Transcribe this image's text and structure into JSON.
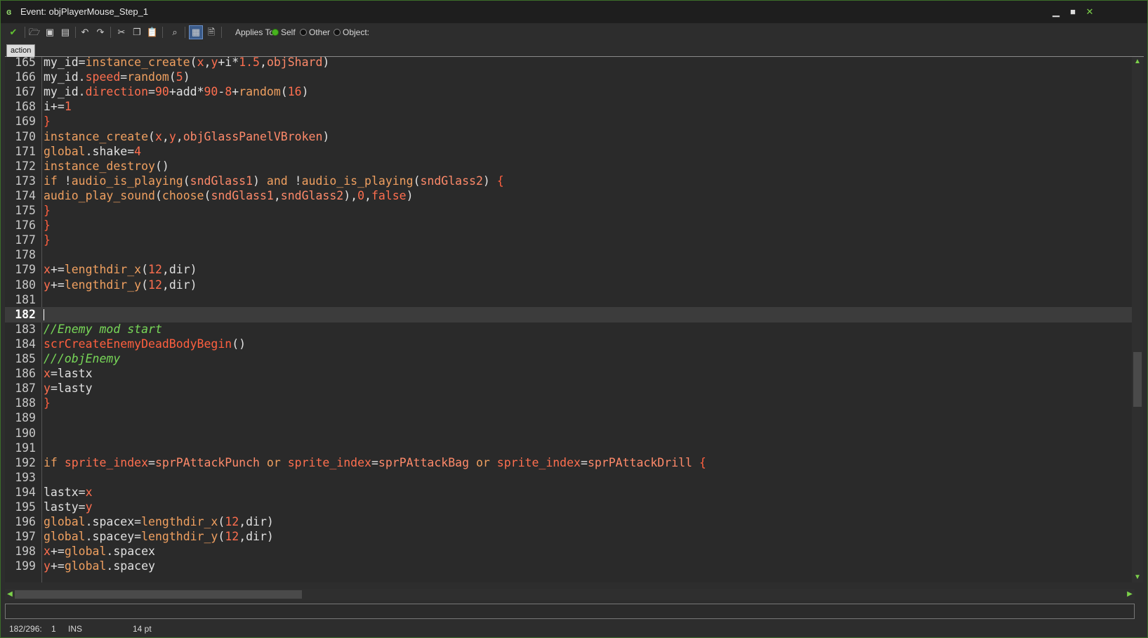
{
  "window": {
    "title": "Event: objPlayerMouse_Step_1",
    "app_icon": "gm-icon",
    "controls": [
      "minimize-icon",
      "maximize-icon",
      "close-icon"
    ]
  },
  "toolbar": {
    "applies_to_label": "Applies To:",
    "options": [
      {
        "label": "Self",
        "selected": true
      },
      {
        "label": "Other",
        "selected": false
      },
      {
        "label": "Object:",
        "selected": false
      }
    ]
  },
  "tab": {
    "label": "action"
  },
  "editor": {
    "current_line": 182,
    "lines": [
      {
        "n": "165",
        "html": "<span class='plain'>my_id</span><span class='plain'>=</span><span class='fn'>instance_create</span><span class='plain'>(</span><span class='var'>x</span><span class='plain'>,</span><span class='var'>y</span><span class='plain'>+i*</span><span class='num'>1.5</span><span class='plain'>,</span><span class='obj'>objShard</span><span class='plain'>)</span>"
      },
      {
        "n": "166",
        "html": "<span class='plain'>my_id.</span><span class='var'>speed</span><span class='plain'>=</span><span class='fn'>random</span><span class='plain'>(</span><span class='num'>5</span><span class='plain'>)</span>"
      },
      {
        "n": "167",
        "html": "<span class='plain'>my_id.</span><span class='var'>direction</span><span class='plain'>=</span><span class='num'>90</span><span class='plain'>+add*</span><span class='num'>90</span><span class='plain'>-</span><span class='num'>8</span><span class='plain'>+</span><span class='fn'>random</span><span class='plain'>(</span><span class='num'>16</span><span class='plain'>)</span>"
      },
      {
        "n": "168",
        "html": "<span class='plain'>i+=</span><span class='num'>1</span>"
      },
      {
        "n": "169",
        "html": "<span class='red'>}</span>"
      },
      {
        "n": "170",
        "html": "<span class='fn'>instance_create</span><span class='plain'>(</span><span class='var'>x</span><span class='plain'>,</span><span class='var'>y</span><span class='plain'>,</span><span class='obj'>objGlassPanelVBroken</span><span class='plain'>)</span>"
      },
      {
        "n": "171",
        "html": "<span class='kw'>global</span><span class='plain'>.shake=</span><span class='num'>4</span>"
      },
      {
        "n": "172",
        "html": "<span class='fn'>instance_destroy</span><span class='plain'>()</span>"
      },
      {
        "n": "173",
        "html": "<span class='kw'>if</span><span class='plain'> !</span><span class='fn'>audio_is_playing</span><span class='plain'>(</span><span class='obj'>sndGlass1</span><span class='plain'>) </span><span class='kw'>and</span><span class='plain'> !</span><span class='fn'>audio_is_playing</span><span class='plain'>(</span><span class='obj'>sndGlass2</span><span class='plain'>) </span><span class='red'>{</span>"
      },
      {
        "n": "174",
        "html": "<span class='fn'>audio_play_sound</span><span class='plain'>(</span><span class='fn'>choose</span><span class='plain'>(</span><span class='obj'>sndGlass1</span><span class='plain'>,</span><span class='obj'>sndGlass2</span><span class='plain'>),</span><span class='num'>0</span><span class='plain'>,</span><span class='var'>false</span><span class='plain'>)</span>"
      },
      {
        "n": "175",
        "html": "<span class='red'>}</span>"
      },
      {
        "n": "176",
        "html": "<span class='red'>}</span>"
      },
      {
        "n": "177",
        "html": "<span class='red'>}</span>"
      },
      {
        "n": "178",
        "html": ""
      },
      {
        "n": "179",
        "html": "<span class='var'>x</span><span class='plain'>+=</span><span class='fn'>lengthdir_x</span><span class='plain'>(</span><span class='num'>12</span><span class='plain'>,dir)</span>"
      },
      {
        "n": "180",
        "html": "<span class='var'>y</span><span class='plain'>+=</span><span class='fn'>lengthdir_y</span><span class='plain'>(</span><span class='num'>12</span><span class='plain'>,dir)</span>"
      },
      {
        "n": "181",
        "html": ""
      },
      {
        "n": "182",
        "html": "",
        "current": true
      },
      {
        "n": "183",
        "html": "<span class='cm'>//Enemy mod start</span>"
      },
      {
        "n": "184",
        "html": "<span class='red'>scrCreateEnemyDeadBodyBegin</span><span class='plain'>()</span>"
      },
      {
        "n": "185",
        "html": "<span class='cm'>///objEnemy</span>"
      },
      {
        "n": "186",
        "html": "<span class='var'>x</span><span class='plain'>=lastx</span>"
      },
      {
        "n": "187",
        "html": "<span class='var'>y</span><span class='plain'>=lasty</span>"
      },
      {
        "n": "188",
        "html": "<span class='red'>}</span>"
      },
      {
        "n": "189",
        "html": ""
      },
      {
        "n": "190",
        "html": ""
      },
      {
        "n": "191",
        "html": ""
      },
      {
        "n": "192",
        "html": "<span class='kw'>if</span><span class='plain'> </span><span class='var'>sprite_index</span><span class='plain'>=</span><span class='obj'>sprPAttackPunch</span><span class='plain'> </span><span class='kw'>or</span><span class='plain'> </span><span class='var'>sprite_index</span><span class='plain'>=</span><span class='obj'>sprPAttackBag</span><span class='plain'> </span><span class='kw'>or</span><span class='plain'> </span><span class='var'>sprite_index</span><span class='plain'>=</span><span class='obj'>sprPAttackDrill</span><span class='plain'> </span><span class='red'>{</span>"
      },
      {
        "n": "193",
        "html": ""
      },
      {
        "n": "194",
        "html": "<span class='plain'>lastx=</span><span class='var'>x</span>"
      },
      {
        "n": "195",
        "html": "<span class='plain'>lasty=</span><span class='var'>y</span>"
      },
      {
        "n": "196",
        "html": "<span class='kw'>global</span><span class='plain'>.spacex=</span><span class='fn'>lengthdir_x</span><span class='plain'>(</span><span class='num'>12</span><span class='plain'>,dir)</span>"
      },
      {
        "n": "197",
        "html": "<span class='kw'>global</span><span class='plain'>.spacey=</span><span class='fn'>lengthdir_y</span><span class='plain'>(</span><span class='num'>12</span><span class='plain'>,dir)</span>"
      },
      {
        "n": "198",
        "html": "<span class='var'>x</span><span class='plain'>+=</span><span class='kw'>global</span><span class='plain'>.spacex</span>"
      },
      {
        "n": "199",
        "html": "<span class='var'>y</span><span class='plain'>+=</span><span class='kw'>global</span><span class='plain'>.spacey</span>"
      }
    ]
  },
  "status": {
    "position": "182/296:",
    "column": "1",
    "mode": "INS",
    "font_size": "14 pt"
  },
  "colors": {
    "keyword": "#f0a060",
    "variable": "#ff6f4f",
    "comment": "#78d858",
    "text": "#e0e0e0",
    "accent_green": "#7bd04a"
  }
}
